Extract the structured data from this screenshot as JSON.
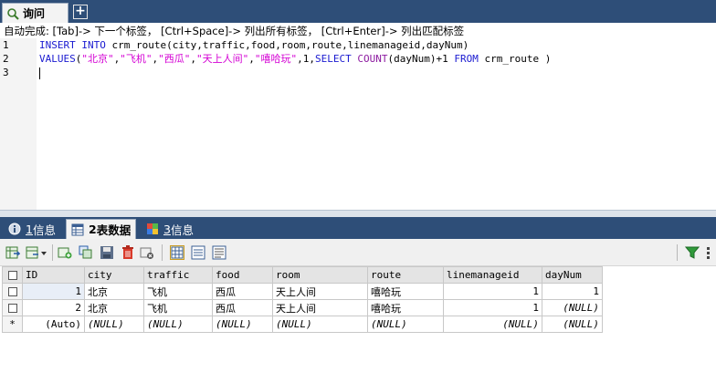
{
  "query_tab": {
    "label": "询问",
    "close": "×"
  },
  "add_tab": "+",
  "hint": "自动完成: [Tab]-> 下一个标签， [Ctrl+Space]-> 列出所有标签， [Ctrl+Enter]-> 列出匹配标签",
  "editor": {
    "line_numbers": [
      "1",
      "2",
      "3"
    ],
    "line1": {
      "kw1": "INSERT INTO",
      "rest": " crm_route(city,traffic,food,room,route,linemanageid,dayNum)"
    },
    "line2": {
      "kw": "VALUES",
      "open": "(",
      "s1": "\"北京\"",
      "c": ",",
      "s2": "\"飞机\"",
      "s3": "\"西瓜\"",
      "s4": "\"天上人间\"",
      "s5": "\"嘻哈玩\"",
      "num": ",1,",
      "select": "SELECT",
      "count": "COUNT",
      "arg": "(dayNum)+1 ",
      "from": "FROM",
      "tail": " crm_route )"
    }
  },
  "result_tabs": [
    {
      "num": "1",
      "label": " 信息"
    },
    {
      "num": "2",
      "label": " 表数据"
    },
    {
      "num": "3",
      "label": " 信息"
    }
  ],
  "grid": {
    "columns": [
      "ID",
      "city",
      "traffic",
      "food",
      "room",
      "route",
      "linemanageid",
      "dayNum"
    ],
    "rows": [
      {
        "marker": "",
        "cells": [
          "1",
          "北京",
          "飞机",
          "西瓜",
          "天上人间",
          "嘻哈玩",
          "1",
          "1"
        ]
      },
      {
        "marker": "",
        "cells": [
          "2",
          "北京",
          "飞机",
          "西瓜",
          "天上人间",
          "嘻哈玩",
          "1",
          "(NULL)"
        ]
      },
      {
        "marker": "*",
        "cells": [
          "(Auto)",
          "(NULL)",
          "(NULL)",
          "(NULL)",
          "(NULL)",
          "(NULL)",
          "(NULL)",
          "(NULL)"
        ]
      }
    ]
  }
}
